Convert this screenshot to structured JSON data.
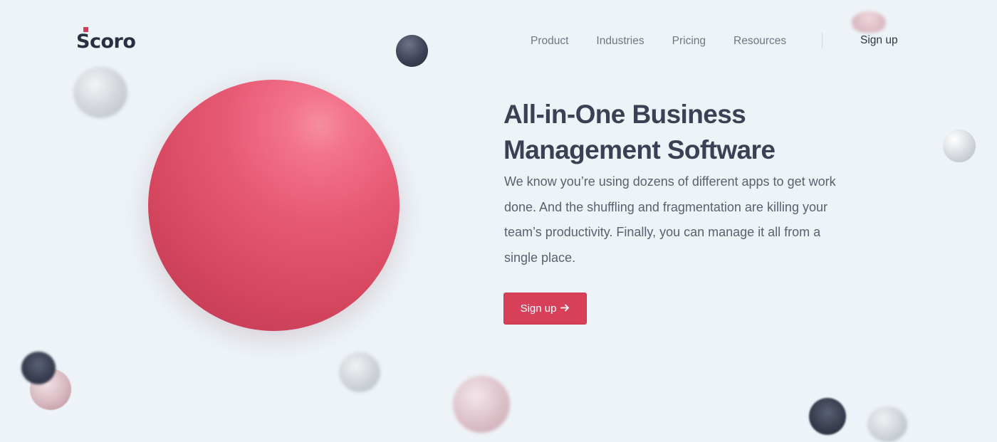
{
  "header": {
    "logo_text": "Scoro",
    "nav": [
      {
        "label": "Product"
      },
      {
        "label": "Industries"
      },
      {
        "label": "Pricing"
      },
      {
        "label": "Resources"
      }
    ],
    "signup_label": "Sign up"
  },
  "hero": {
    "title": "All-in-One Business Management Software",
    "description": "We know you’re using dozens of different apps to get work done. And the shuffling and fragmentation are killing your team’s productivity. Finally, you can manage it all from a single place.",
    "cta_label": "Sign up",
    "cta_icon": "arrow-right-icon"
  },
  "colors": {
    "background": "#edf3f7",
    "accent": "#d8405a",
    "text_dark": "#3a4154",
    "text_muted": "#6f7684"
  }
}
